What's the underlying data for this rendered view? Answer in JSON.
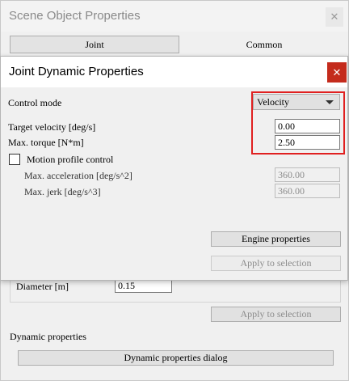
{
  "background_window": {
    "title": "Scene Object Properties",
    "close_glyph": "✕",
    "tabs": [
      {
        "label": "Joint"
      },
      {
        "label": "Common"
      }
    ],
    "diameter_label": "Diameter [m]",
    "diameter_value": "0.15",
    "apply_label": "Apply to selection",
    "dynamic_properties_label": "Dynamic properties",
    "dynamic_dialog_button": "Dynamic properties dialog"
  },
  "dialog": {
    "title": "Joint Dynamic Properties",
    "close_glyph": "✕",
    "control_mode_label": "Control mode",
    "control_mode_value": "Velocity",
    "target_velocity_label": "Target velocity [deg/s]",
    "target_velocity_value": "0.00",
    "max_torque_label": "Max. torque [N*m]",
    "max_torque_value": "2.50",
    "motion_profile_label": "Motion profile control",
    "max_acceleration_label": "Max. acceleration [deg/s^2]",
    "max_acceleration_value": "360.00",
    "max_jerk_label": "Max. jerk [deg/s^3]",
    "max_jerk_value": "360.00",
    "engine_properties_button": "Engine properties",
    "apply_button": "Apply to selection"
  },
  "colors": {
    "close_button_active": "#c42b1c",
    "highlight": "#e02020"
  },
  "icons": {
    "close": "close-icon",
    "dropdown": "chevron-down-icon"
  }
}
